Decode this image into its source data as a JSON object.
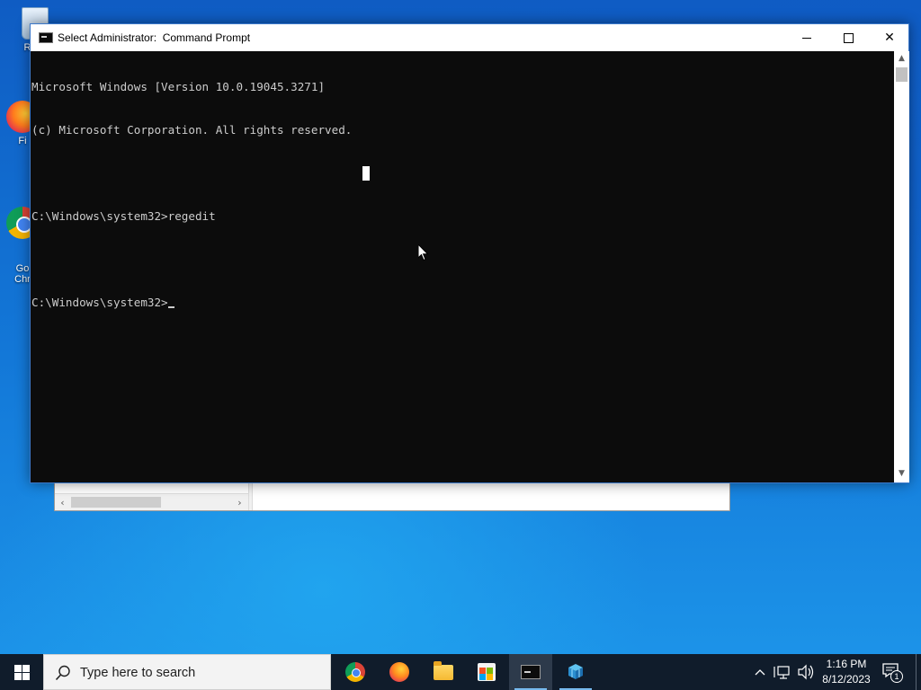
{
  "desktop": {
    "icons": [
      {
        "label": "Recy",
        "icon": "recycle-bin-icon"
      },
      {
        "label": "Fi",
        "icon": "firefox-icon"
      },
      {
        "label": "Go\nChr",
        "icon": "chrome-icon"
      }
    ]
  },
  "cmd_window": {
    "title": "Select Administrator:  Command Prompt",
    "icon": "console-icon",
    "controls": {
      "minimize": "minimize",
      "maximize": "maximize",
      "close": "close"
    },
    "lines": [
      "Microsoft Windows [Version 10.0.19045.3271]",
      "(c) Microsoft Corporation. All rights reserved.",
      "",
      "C:\\Windows\\system32>regedit",
      "",
      "C:\\Windows\\system32>"
    ],
    "colors": {
      "background": "#0c0c0c",
      "text": "#cccccc"
    }
  },
  "regedit_window": {
    "scroll_left": "‹",
    "scroll_right": "›"
  },
  "taskbar": {
    "search_placeholder": "Type here to search",
    "apps": [
      {
        "name": "Google Chrome",
        "icon": "chrome-icon"
      },
      {
        "name": "Firefox",
        "icon": "firefox-icon"
      },
      {
        "name": "File Explorer",
        "icon": "folder-icon"
      },
      {
        "name": "Microsoft Store",
        "icon": "store-icon"
      },
      {
        "name": "Command Prompt",
        "icon": "cmd-icon",
        "active": true
      },
      {
        "name": "Registry Editor",
        "icon": "regedit-icon",
        "running": true
      }
    ],
    "clock": {
      "time": "1:16 PM",
      "date": "8/12/2023"
    },
    "notifications_count": "1",
    "colors": {
      "taskbar": "#101c2b",
      "accent": "#76b9ed"
    }
  }
}
